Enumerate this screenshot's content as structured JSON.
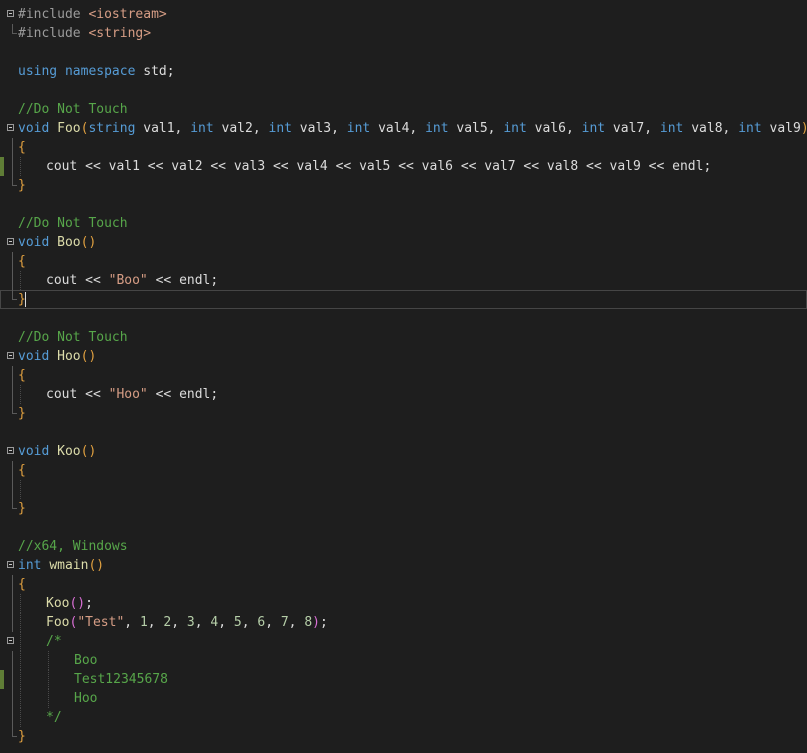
{
  "colors": {
    "background": "#1e1e1e",
    "preprocessor": "#9b9b9b",
    "include": "#d69d85",
    "keyword": "#569cd6",
    "plain": "#dcdcdc",
    "comment": "#57a64a",
    "function": "#dcdcaa",
    "string": "#d69d85",
    "brace": "#e0a040",
    "paren_inner": "#da70d6",
    "number": "#b5cea8",
    "changed_marker": "#5f7d36"
  },
  "lines": [
    {
      "fold": true,
      "tokens": [
        [
          "#include",
          "preprocessor"
        ],
        [
          " ",
          "plain"
        ],
        [
          "<iostream>",
          "include"
        ]
      ]
    },
    {
      "guide_end": true,
      "tokens": [
        [
          "#include",
          "preprocessor"
        ],
        [
          " ",
          "plain"
        ],
        [
          "<string>",
          "include"
        ]
      ]
    },
    {
      "tokens": []
    },
    {
      "tokens": [
        [
          "using",
          "keyword"
        ],
        [
          " ",
          "plain"
        ],
        [
          "namespace",
          "keyword"
        ],
        [
          " std;",
          "plain"
        ]
      ]
    },
    {
      "tokens": []
    },
    {
      "tokens": [
        [
          "//Do Not Touch",
          "comment"
        ]
      ]
    },
    {
      "fold": true,
      "tokens": [
        [
          "void",
          "keyword"
        ],
        [
          " ",
          "plain"
        ],
        [
          "Foo",
          "function"
        ],
        [
          "(",
          "brace"
        ],
        [
          "string",
          "keyword"
        ],
        [
          " val1, ",
          "plain"
        ],
        [
          "int",
          "keyword"
        ],
        [
          " val2, ",
          "plain"
        ],
        [
          "int",
          "keyword"
        ],
        [
          " val3, ",
          "plain"
        ],
        [
          "int",
          "keyword"
        ],
        [
          " val4, ",
          "plain"
        ],
        [
          "int",
          "keyword"
        ],
        [
          " val5, ",
          "plain"
        ],
        [
          "int",
          "keyword"
        ],
        [
          " val6, ",
          "plain"
        ],
        [
          "int",
          "keyword"
        ],
        [
          " val7, ",
          "plain"
        ],
        [
          "int",
          "keyword"
        ],
        [
          " val8, ",
          "plain"
        ],
        [
          "int",
          "keyword"
        ],
        [
          " val9",
          "plain"
        ],
        [
          ")",
          "brace"
        ]
      ]
    },
    {
      "guide": true,
      "tokens": [
        [
          "{",
          "brace"
        ]
      ]
    },
    {
      "guide": true,
      "changed": true,
      "indent": 1,
      "tokens": [
        [
          "cout << val1 << val2 << val3 << val4 << val5 << val6 << val7 << val8 << val9 << ",
          "plain"
        ],
        [
          "endl",
          "plain"
        ],
        [
          ";",
          "plain"
        ]
      ]
    },
    {
      "guide_end": true,
      "tokens": [
        [
          "}",
          "brace"
        ]
      ]
    },
    {
      "tokens": []
    },
    {
      "tokens": [
        [
          "//Do Not Touch",
          "comment"
        ]
      ]
    },
    {
      "fold": true,
      "tokens": [
        [
          "void",
          "keyword"
        ],
        [
          " ",
          "plain"
        ],
        [
          "Boo",
          "function"
        ],
        [
          "()",
          "brace"
        ]
      ]
    },
    {
      "guide": true,
      "tokens": [
        [
          "{",
          "brace"
        ]
      ]
    },
    {
      "guide": true,
      "indent": 1,
      "tokens": [
        [
          "cout << ",
          "plain"
        ],
        [
          "\"Boo\"",
          "string"
        ],
        [
          " << endl;",
          "plain"
        ]
      ]
    },
    {
      "guide_end": true,
      "current": true,
      "cursor": true,
      "tokens": [
        [
          "}",
          "brace"
        ]
      ]
    },
    {
      "tokens": []
    },
    {
      "tokens": [
        [
          "//Do Not Touch",
          "comment"
        ]
      ]
    },
    {
      "fold": true,
      "tokens": [
        [
          "void",
          "keyword"
        ],
        [
          " ",
          "plain"
        ],
        [
          "Hoo",
          "function"
        ],
        [
          "()",
          "brace"
        ]
      ]
    },
    {
      "guide": true,
      "tokens": [
        [
          "{",
          "brace"
        ]
      ]
    },
    {
      "guide": true,
      "indent": 1,
      "tokens": [
        [
          "cout << ",
          "plain"
        ],
        [
          "\"Hoo\"",
          "string"
        ],
        [
          " << endl;",
          "plain"
        ]
      ]
    },
    {
      "guide_end": true,
      "tokens": [
        [
          "}",
          "brace"
        ]
      ]
    },
    {
      "tokens": []
    },
    {
      "fold": true,
      "tokens": [
        [
          "void",
          "keyword"
        ],
        [
          " ",
          "plain"
        ],
        [
          "Koo",
          "function"
        ],
        [
          "()",
          "brace"
        ]
      ]
    },
    {
      "guide": true,
      "tokens": [
        [
          "{",
          "brace"
        ]
      ]
    },
    {
      "guide": true,
      "indent": 1,
      "tokens": []
    },
    {
      "guide_end": true,
      "tokens": [
        [
          "}",
          "brace"
        ]
      ]
    },
    {
      "tokens": []
    },
    {
      "tokens": [
        [
          "//x64, Windows",
          "comment"
        ]
      ]
    },
    {
      "fold": true,
      "tokens": [
        [
          "int",
          "keyword"
        ],
        [
          " ",
          "plain"
        ],
        [
          "wmain",
          "function"
        ],
        [
          "()",
          "brace"
        ]
      ]
    },
    {
      "guide": true,
      "tokens": [
        [
          "{",
          "brace"
        ]
      ]
    },
    {
      "guide": true,
      "indent": 1,
      "tokens": [
        [
          "Koo",
          "function"
        ],
        [
          "()",
          "paren_inner"
        ],
        [
          ";",
          "plain"
        ]
      ]
    },
    {
      "guide": true,
      "indent": 1,
      "tokens": [
        [
          "Foo",
          "function"
        ],
        [
          "(",
          "paren_inner"
        ],
        [
          "\"Test\"",
          "string"
        ],
        [
          ", ",
          "plain"
        ],
        [
          "1",
          "number"
        ],
        [
          ", ",
          "plain"
        ],
        [
          "2",
          "number"
        ],
        [
          ", ",
          "plain"
        ],
        [
          "3",
          "number"
        ],
        [
          ", ",
          "plain"
        ],
        [
          "4",
          "number"
        ],
        [
          ", ",
          "plain"
        ],
        [
          "5",
          "number"
        ],
        [
          ", ",
          "plain"
        ],
        [
          "6",
          "number"
        ],
        [
          ", ",
          "plain"
        ],
        [
          "7",
          "number"
        ],
        [
          ", ",
          "plain"
        ],
        [
          "8",
          "number"
        ],
        [
          ")",
          "paren_inner"
        ],
        [
          ";",
          "plain"
        ]
      ]
    },
    {
      "fold": true,
      "guide": true,
      "indent": 1,
      "tokens": [
        [
          "/*",
          "comment"
        ]
      ]
    },
    {
      "guide": true,
      "indent": 2,
      "tokens": [
        [
          "Boo",
          "comment"
        ]
      ]
    },
    {
      "guide": true,
      "changed": true,
      "indent": 2,
      "tokens": [
        [
          "Test12345678",
          "comment"
        ]
      ]
    },
    {
      "guide": true,
      "indent": 2,
      "tokens": [
        [
          "Hoo",
          "comment"
        ]
      ]
    },
    {
      "guide": true,
      "indent": 1,
      "tokens": [
        [
          "*/",
          "comment"
        ]
      ]
    },
    {
      "guide_end": true,
      "tokens": [
        [
          "}",
          "brace"
        ]
      ]
    }
  ]
}
